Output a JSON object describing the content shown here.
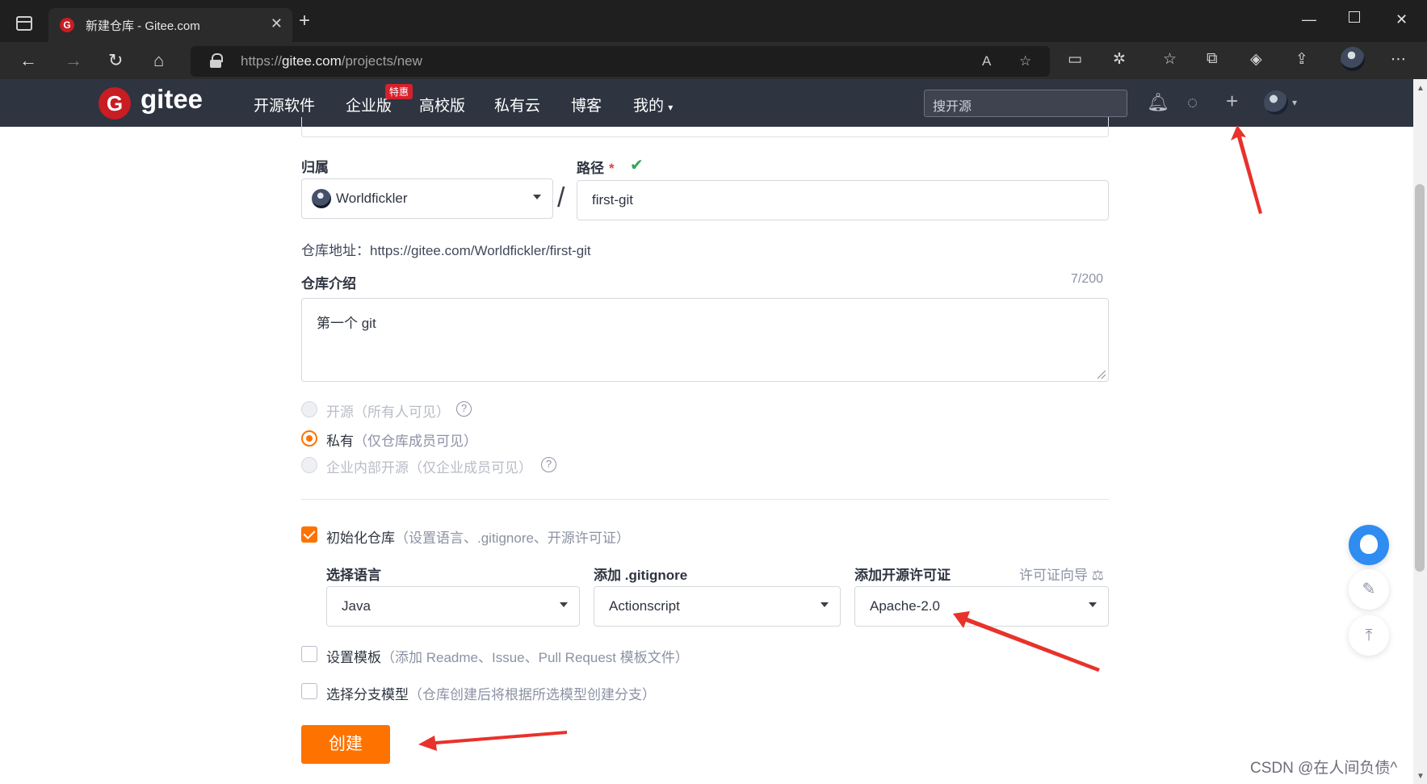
{
  "browser": {
    "tab_title": "新建仓库 - Gitee.com",
    "url_scheme": "https://",
    "url_host": "gitee.com",
    "url_path": "/projects/new",
    "new_tab": "+",
    "close_tab": "✕"
  },
  "header": {
    "logo_text": "gitee",
    "nav": [
      "开源软件",
      "企业版",
      "高校版",
      "私有云",
      "博客",
      "我的"
    ],
    "badge": "特惠",
    "search_placeholder": "搜开源"
  },
  "form": {
    "owner_label": "归属",
    "owner_value": "Worldfickler",
    "path_label": "路径",
    "path_required": "*",
    "path_value": "first-git",
    "repo_address": "仓库地址：https://gitee.com/Worldfickler/first-git",
    "intro_label": "仓库介绍",
    "intro_counter": "7/200",
    "intro_value": "第一个 git",
    "visibility": {
      "open": {
        "label": "开源",
        "note": "（所有人可见）"
      },
      "private": {
        "label": "私有",
        "note": "（仅仓库成员可见）"
      },
      "internal": {
        "label": "企业内部开源",
        "note": "（仅企业成员可见）"
      }
    },
    "init": {
      "label": "初始化仓库",
      "note": "（设置语言、.gitignore、开源许可证）",
      "checked": true
    },
    "language_label": "选择语言",
    "language_value": "Java",
    "gitignore_label": "添加 .gitignore",
    "gitignore_value": "Actionscript",
    "license_label": "添加开源许可证",
    "license_guide": "许可证向导",
    "license_value": "Apache-2.0",
    "template": {
      "label": "设置模板",
      "note": "（添加 Readme、Issue、Pull Request 模板文件）",
      "checked": false
    },
    "branch": {
      "label": "选择分支模型",
      "note": "（仓库创建后将根据所选模型创建分支）",
      "checked": false
    },
    "submit_label": "创建"
  },
  "watermark": "CSDN @在人间负债^",
  "colors": {
    "brand": "#c71d23",
    "accent": "#fe7300",
    "header_bg": "#2e3440",
    "annotation": "#e8322b"
  }
}
